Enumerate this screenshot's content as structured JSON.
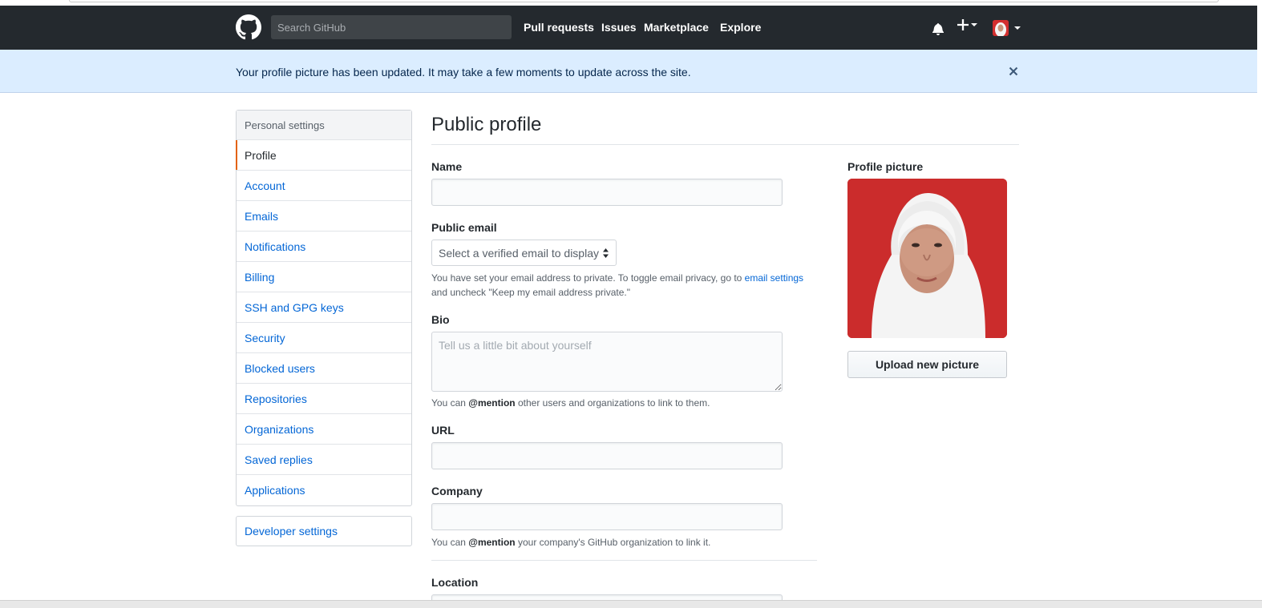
{
  "header": {
    "search_placeholder": "Search GitHub",
    "nav": [
      "Pull requests",
      "Issues",
      "Marketplace",
      "Explore"
    ]
  },
  "flash": {
    "message": "Your profile picture has been updated. It may take a few moments to update across the site."
  },
  "sidebar": {
    "heading": "Personal settings",
    "items": [
      "Profile",
      "Account",
      "Emails",
      "Notifications",
      "Billing",
      "SSH and GPG keys",
      "Security",
      "Blocked users",
      "Repositories",
      "Organizations",
      "Saved replies",
      "Applications"
    ],
    "selected": "Profile",
    "developer": "Developer settings"
  },
  "main": {
    "title": "Public profile",
    "name_label": "Name",
    "name_value": "",
    "email_label": "Public email",
    "email_select": "Select a verified email to display",
    "email_note_1": "You have set your email address to private. To toggle email privacy, go to ",
    "email_note_link": "email settings",
    "email_note_2": "and uncheck \"Keep my email address private.\"",
    "bio_label": "Bio",
    "bio_placeholder": "Tell us a little bit about yourself",
    "bio_note_pre": "You can ",
    "bio_note_bold": "@mention",
    "bio_note_post": " other users and organizations to link to them.",
    "url_label": "URL",
    "company_label": "Company",
    "company_note_pre": "You can ",
    "company_note_bold": "@mention",
    "company_note_post": " your company's GitHub organization to link it.",
    "location_label": "Location"
  },
  "profile_picture": {
    "label": "Profile picture",
    "upload_label": "Upload new picture"
  },
  "colors": {
    "header_bg": "#24292e",
    "flash_bg": "#dbedff",
    "link": "#0366d6",
    "selected_accent": "#e36209",
    "photo_bg": "#cc2a2a"
  }
}
